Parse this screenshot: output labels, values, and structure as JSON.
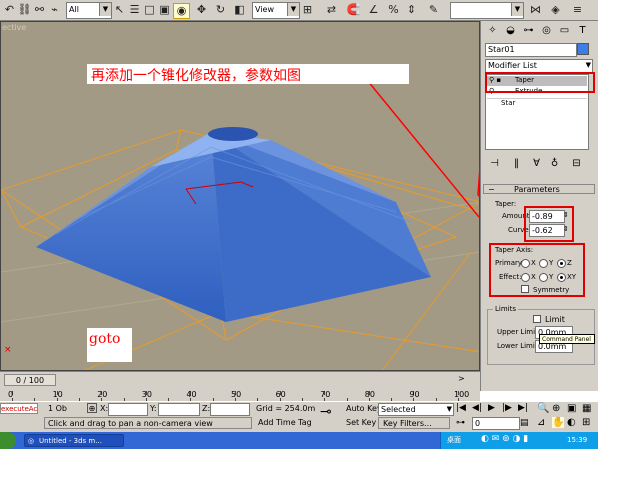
{
  "toolbar": {
    "selection_filter": "All",
    "reference_coord": "View",
    "icons": [
      "undo-icon",
      "redo-icon",
      "link-icon",
      "unlink-icon",
      "bind-icon",
      "select-icon",
      "select-region-icon",
      "window-crossing-icon",
      "move-icon",
      "rotate-icon",
      "scale-icon",
      "mirror-icon",
      "snap-icon",
      "angle-snap-icon",
      "percent-snap-icon",
      "spinner-snap-icon",
      "named-selection-icon",
      "align-icon"
    ]
  },
  "viewport": {
    "label": "ective",
    "annotation_main": "再添加一个锥化修改器，参数如图",
    "annotation_goto": "goto"
  },
  "command_panel": {
    "object_name": "Star01",
    "modifier_list_label": "Modifier List",
    "stack": [
      "Taper",
      "Extrude",
      "Star"
    ],
    "parameters_title": "Parameters",
    "taper_group": "Taper:",
    "amount_label": "Amount:",
    "amount_value": "-0.89",
    "curve_label": "Curve:",
    "curve_value": "-0.62",
    "taper_axis_group": "Taper Axis:",
    "primary_label": "Primary:",
    "effect_label": "Effect:",
    "primary_options": [
      "X",
      "Y",
      "Z"
    ],
    "primary_selected": "Z",
    "effect_options": [
      "X",
      "Y",
      "XY"
    ],
    "effect_selected": "XY",
    "symmetry_label": "Symmetry",
    "limits_group": "Limits",
    "limit_effect_label": "Limit",
    "upper_limit_label": "Upper Limit:",
    "upper_limit_value": "0.0mm",
    "lower_limit_label": "Lower Limit:",
    "lower_limit_value": "0.0mm",
    "tooltip": "Command Panel"
  },
  "timeline": {
    "frame_display": "0 / 100",
    "ticks": [
      "0",
      "10",
      "20",
      "30",
      "40",
      "50",
      "60",
      "70",
      "80",
      "90",
      "100"
    ]
  },
  "status": {
    "script_label": "executeAc",
    "selection_count": "1 Ob",
    "x_label": "X:",
    "y_label": "Y:",
    "z_label": "Z:",
    "grid": "Grid = 254.0m",
    "auto_key": "Auto Key",
    "set_key": "Set Key",
    "key_mode": "Selected",
    "key_filters": "Key Filters...",
    "prompt": "Click and drag to pan a non-camera view",
    "add_time_tag": "Add Time Tag",
    "current_frame": "0"
  },
  "taskbar": {
    "task_label": "Untitled - 3ds m...",
    "desktop_label": "桌面",
    "clock": "15:39"
  }
}
